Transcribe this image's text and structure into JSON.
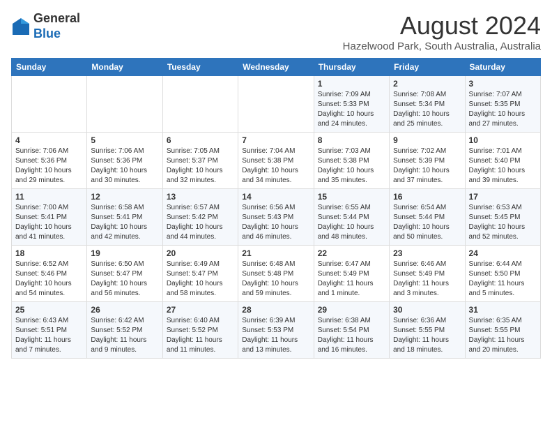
{
  "header": {
    "logo_general": "General",
    "logo_blue": "Blue",
    "month_title": "August 2024",
    "subtitle": "Hazelwood Park, South Australia, Australia"
  },
  "days_of_week": [
    "Sunday",
    "Monday",
    "Tuesday",
    "Wednesday",
    "Thursday",
    "Friday",
    "Saturday"
  ],
  "weeks": [
    [
      {
        "day": "",
        "info": ""
      },
      {
        "day": "",
        "info": ""
      },
      {
        "day": "",
        "info": ""
      },
      {
        "day": "",
        "info": ""
      },
      {
        "day": "1",
        "info": "Sunrise: 7:09 AM\nSunset: 5:33 PM\nDaylight: 10 hours\nand 24 minutes."
      },
      {
        "day": "2",
        "info": "Sunrise: 7:08 AM\nSunset: 5:34 PM\nDaylight: 10 hours\nand 25 minutes."
      },
      {
        "day": "3",
        "info": "Sunrise: 7:07 AM\nSunset: 5:35 PM\nDaylight: 10 hours\nand 27 minutes."
      }
    ],
    [
      {
        "day": "4",
        "info": "Sunrise: 7:06 AM\nSunset: 5:36 PM\nDaylight: 10 hours\nand 29 minutes."
      },
      {
        "day": "5",
        "info": "Sunrise: 7:06 AM\nSunset: 5:36 PM\nDaylight: 10 hours\nand 30 minutes."
      },
      {
        "day": "6",
        "info": "Sunrise: 7:05 AM\nSunset: 5:37 PM\nDaylight: 10 hours\nand 32 minutes."
      },
      {
        "day": "7",
        "info": "Sunrise: 7:04 AM\nSunset: 5:38 PM\nDaylight: 10 hours\nand 34 minutes."
      },
      {
        "day": "8",
        "info": "Sunrise: 7:03 AM\nSunset: 5:38 PM\nDaylight: 10 hours\nand 35 minutes."
      },
      {
        "day": "9",
        "info": "Sunrise: 7:02 AM\nSunset: 5:39 PM\nDaylight: 10 hours\nand 37 minutes."
      },
      {
        "day": "10",
        "info": "Sunrise: 7:01 AM\nSunset: 5:40 PM\nDaylight: 10 hours\nand 39 minutes."
      }
    ],
    [
      {
        "day": "11",
        "info": "Sunrise: 7:00 AM\nSunset: 5:41 PM\nDaylight: 10 hours\nand 41 minutes."
      },
      {
        "day": "12",
        "info": "Sunrise: 6:58 AM\nSunset: 5:41 PM\nDaylight: 10 hours\nand 42 minutes."
      },
      {
        "day": "13",
        "info": "Sunrise: 6:57 AM\nSunset: 5:42 PM\nDaylight: 10 hours\nand 44 minutes."
      },
      {
        "day": "14",
        "info": "Sunrise: 6:56 AM\nSunset: 5:43 PM\nDaylight: 10 hours\nand 46 minutes."
      },
      {
        "day": "15",
        "info": "Sunrise: 6:55 AM\nSunset: 5:44 PM\nDaylight: 10 hours\nand 48 minutes."
      },
      {
        "day": "16",
        "info": "Sunrise: 6:54 AM\nSunset: 5:44 PM\nDaylight: 10 hours\nand 50 minutes."
      },
      {
        "day": "17",
        "info": "Sunrise: 6:53 AM\nSunset: 5:45 PM\nDaylight: 10 hours\nand 52 minutes."
      }
    ],
    [
      {
        "day": "18",
        "info": "Sunrise: 6:52 AM\nSunset: 5:46 PM\nDaylight: 10 hours\nand 54 minutes."
      },
      {
        "day": "19",
        "info": "Sunrise: 6:50 AM\nSunset: 5:47 PM\nDaylight: 10 hours\nand 56 minutes."
      },
      {
        "day": "20",
        "info": "Sunrise: 6:49 AM\nSunset: 5:47 PM\nDaylight: 10 hours\nand 58 minutes."
      },
      {
        "day": "21",
        "info": "Sunrise: 6:48 AM\nSunset: 5:48 PM\nDaylight: 10 hours\nand 59 minutes."
      },
      {
        "day": "22",
        "info": "Sunrise: 6:47 AM\nSunset: 5:49 PM\nDaylight: 11 hours\nand 1 minute."
      },
      {
        "day": "23",
        "info": "Sunrise: 6:46 AM\nSunset: 5:49 PM\nDaylight: 11 hours\nand 3 minutes."
      },
      {
        "day": "24",
        "info": "Sunrise: 6:44 AM\nSunset: 5:50 PM\nDaylight: 11 hours\nand 5 minutes."
      }
    ],
    [
      {
        "day": "25",
        "info": "Sunrise: 6:43 AM\nSunset: 5:51 PM\nDaylight: 11 hours\nand 7 minutes."
      },
      {
        "day": "26",
        "info": "Sunrise: 6:42 AM\nSunset: 5:52 PM\nDaylight: 11 hours\nand 9 minutes."
      },
      {
        "day": "27",
        "info": "Sunrise: 6:40 AM\nSunset: 5:52 PM\nDaylight: 11 hours\nand 11 minutes."
      },
      {
        "day": "28",
        "info": "Sunrise: 6:39 AM\nSunset: 5:53 PM\nDaylight: 11 hours\nand 13 minutes."
      },
      {
        "day": "29",
        "info": "Sunrise: 6:38 AM\nSunset: 5:54 PM\nDaylight: 11 hours\nand 16 minutes."
      },
      {
        "day": "30",
        "info": "Sunrise: 6:36 AM\nSunset: 5:55 PM\nDaylight: 11 hours\nand 18 minutes."
      },
      {
        "day": "31",
        "info": "Sunrise: 6:35 AM\nSunset: 5:55 PM\nDaylight: 11 hours\nand 20 minutes."
      }
    ]
  ]
}
